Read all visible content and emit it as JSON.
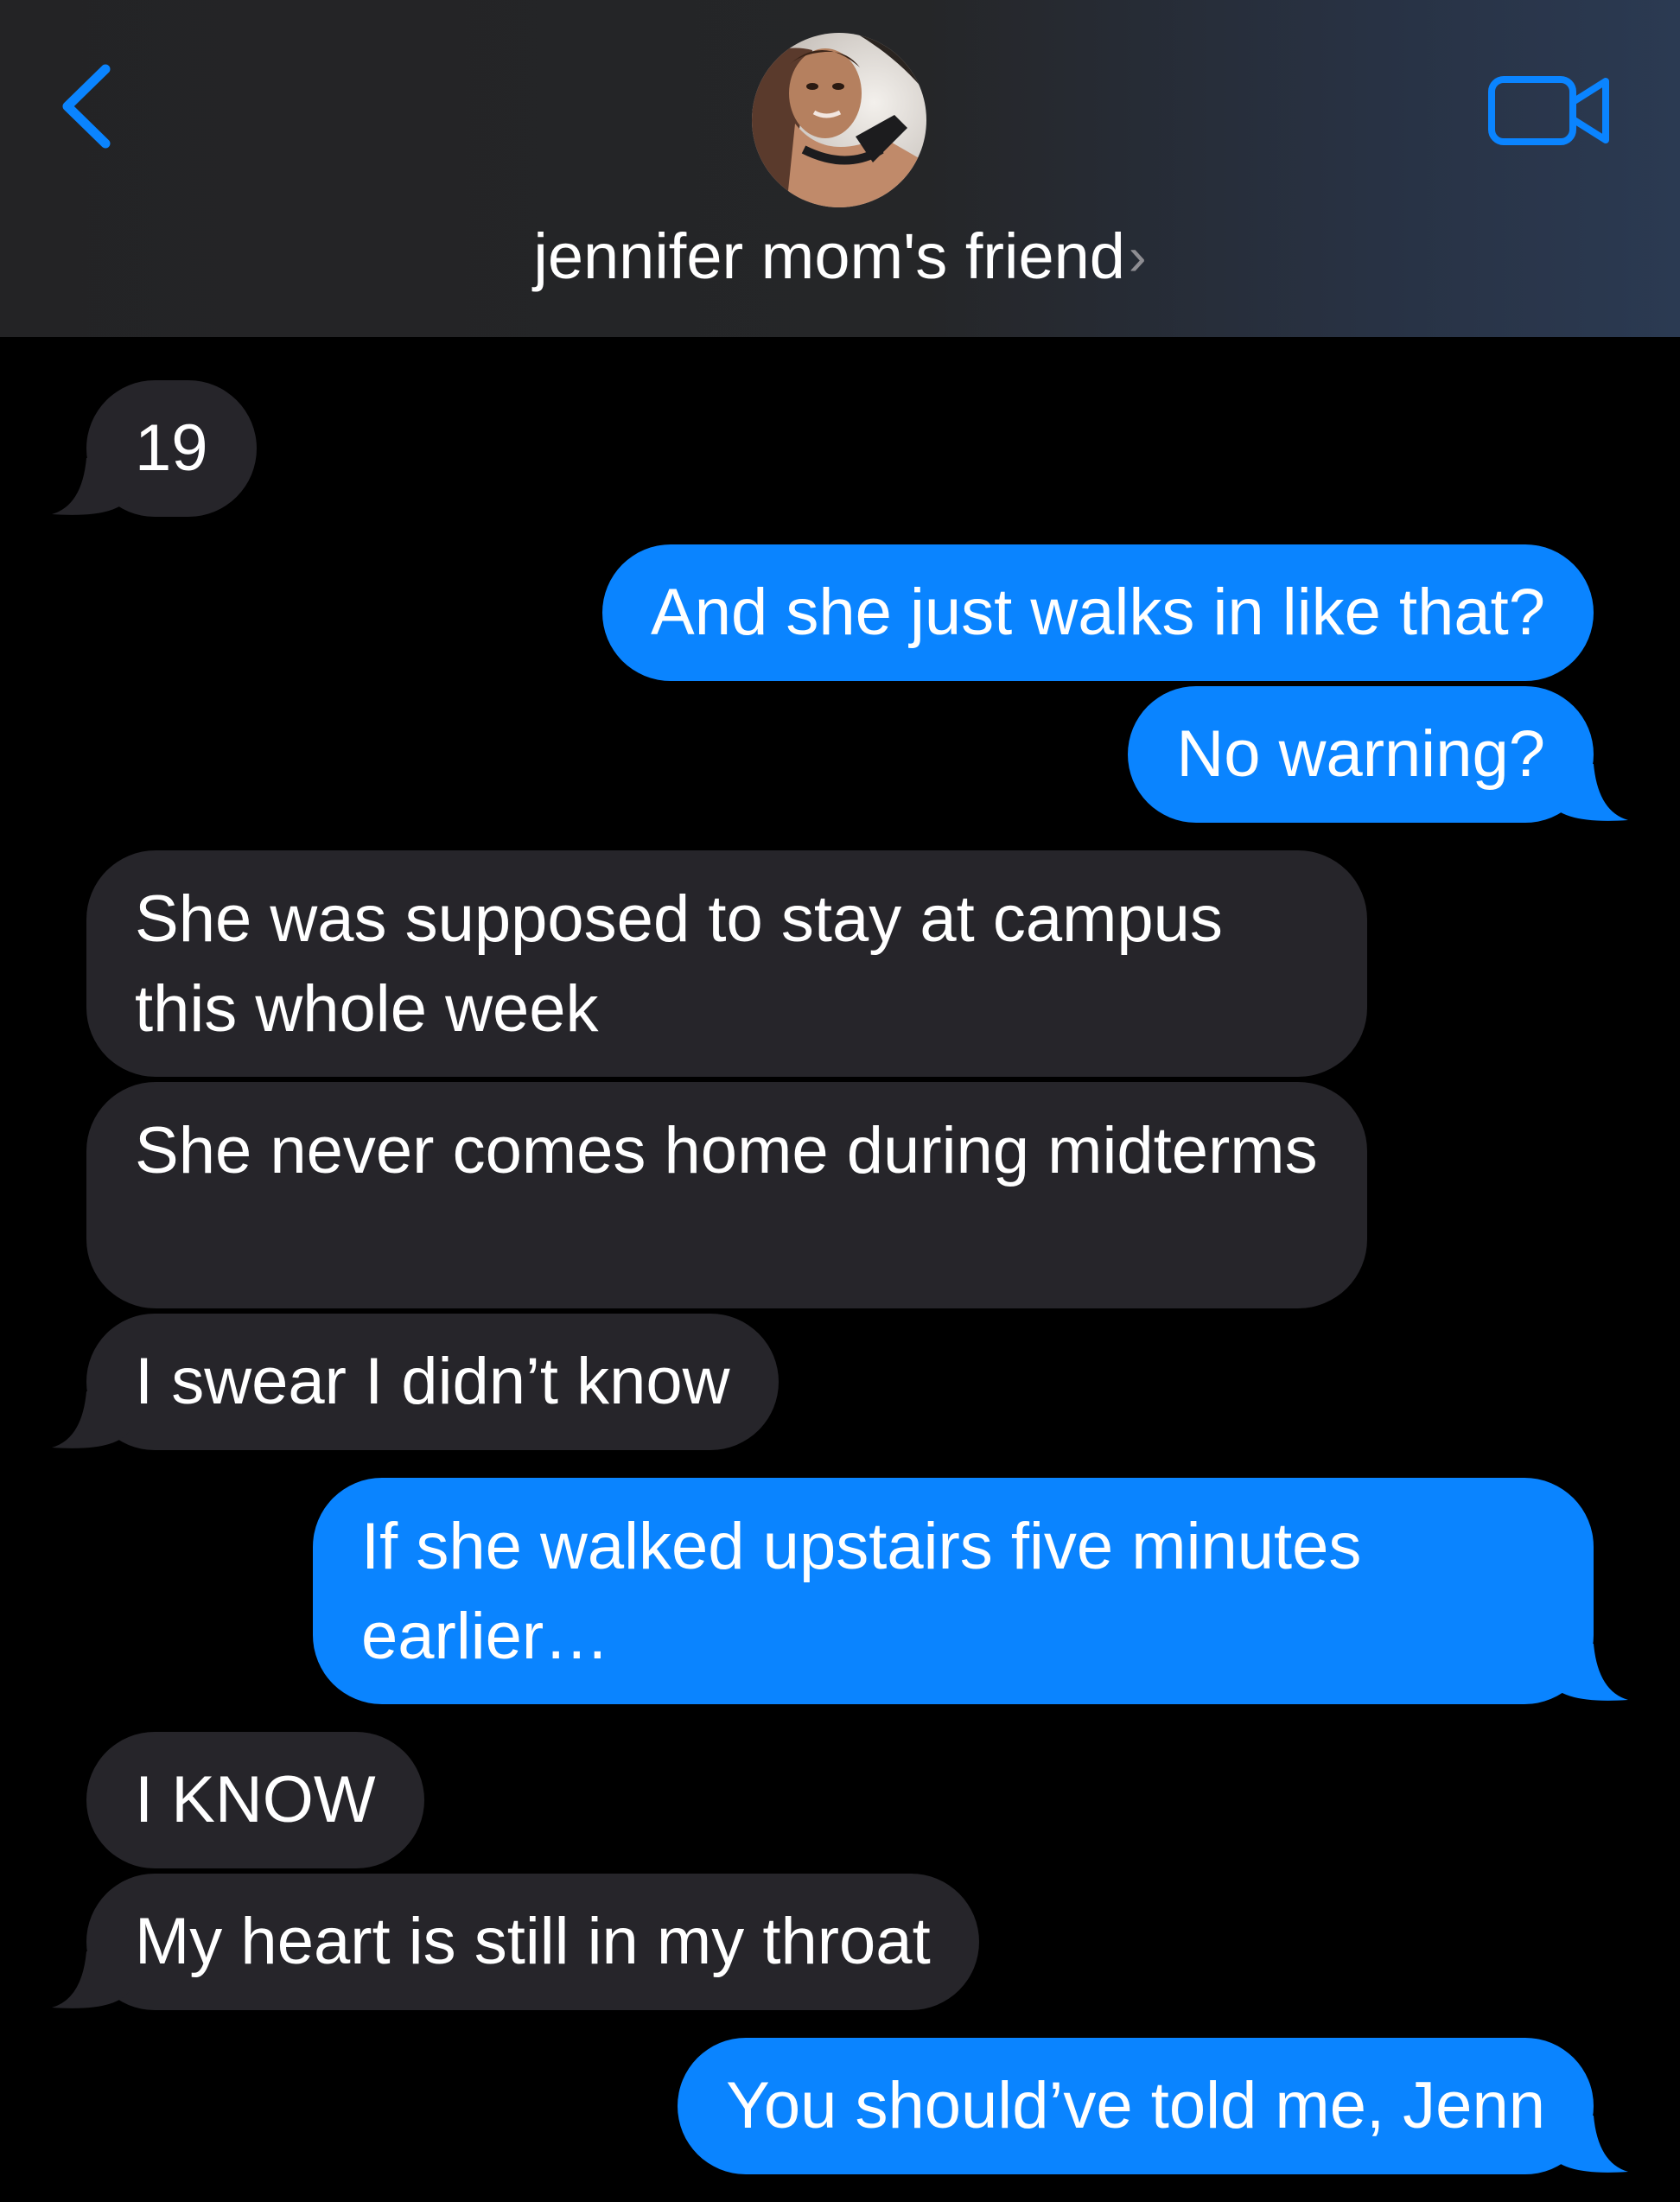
{
  "header": {
    "contact_name": "jennifer mom's friend",
    "chevron": "›",
    "back_icon": "chevron-left-icon",
    "video_icon": "video-camera-icon",
    "accent_color": "#0a84ff"
  },
  "messages": [
    {
      "direction": "incoming",
      "text": "19"
    },
    {
      "direction": "outgoing",
      "text": "And she just walks in like that?"
    },
    {
      "direction": "outgoing",
      "text": "No warning?"
    },
    {
      "direction": "incoming",
      "text": "She was supposed to stay at campus this whole week"
    },
    {
      "direction": "incoming",
      "text": "She never comes home during midterms"
    },
    {
      "direction": "incoming",
      "text": "I swear I didn’t know"
    },
    {
      "direction": "outgoing",
      "text": "If she walked upstairs five minutes earlier…"
    },
    {
      "direction": "incoming",
      "text": "I KNOW"
    },
    {
      "direction": "incoming",
      "text": "My heart is still in my throat"
    },
    {
      "direction": "outgoing",
      "text": "You should’ve told me, Jenn"
    }
  ],
  "colors": {
    "incoming_bubble": "#26252a",
    "outgoing_bubble": "#0a84ff",
    "background": "#000000"
  }
}
